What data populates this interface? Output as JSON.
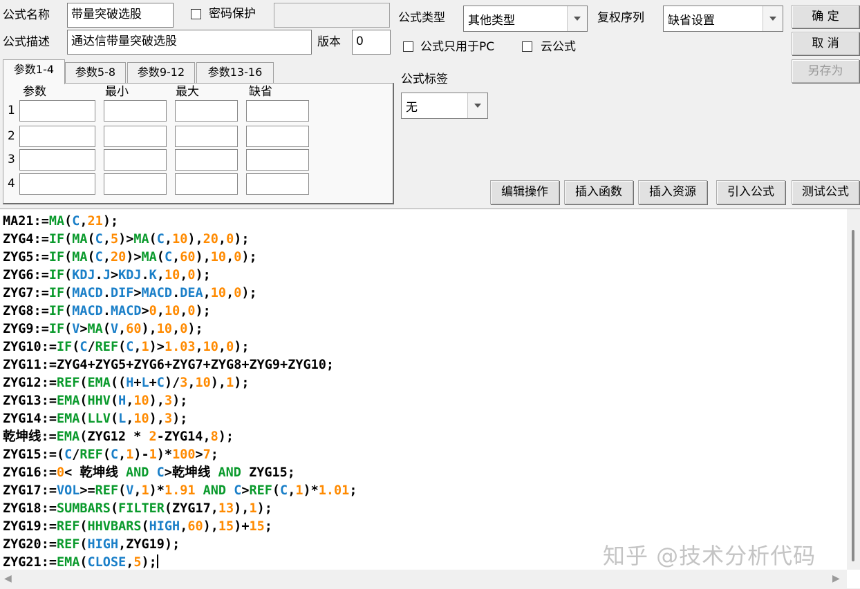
{
  "header": {
    "formula_name_label": "公式名称",
    "formula_name_value": "带量突破选股",
    "password_label": "密码保护",
    "password_checked": false,
    "password_value": "",
    "formula_desc_label": "公式描述",
    "formula_desc_value": "通达信带量突破选股",
    "version_label": "版本",
    "version_value": "0"
  },
  "right": {
    "type_label": "公式类型",
    "type_value": "其他类型",
    "fq_label": "复权序列",
    "fq_value": "缺省设置",
    "pc_only_label": "公式只用于PC",
    "pc_only_checked": false,
    "cloud_label": "云公式",
    "cloud_checked": false,
    "tag_label": "公式标签",
    "tag_value": "无"
  },
  "buttons": {
    "ok": "确  定",
    "cancel": "取  消",
    "save_as": "另存为",
    "edit_ops": "编辑操作",
    "insert_func": "插入函数",
    "insert_res": "插入资源",
    "import_formula": "引入公式",
    "test_formula": "测试公式"
  },
  "tabs": [
    "参数1-4",
    "参数5-8",
    "参数9-12",
    "参数13-16"
  ],
  "params": {
    "headers": [
      "参数",
      "最小",
      "最大",
      "缺省"
    ],
    "rows": [
      "1",
      "2",
      "3",
      "4"
    ]
  },
  "code_lines": [
    "MA21:=MA(C,21);",
    "ZYG4:=IF(MA(C,5)>MA(C,10),20,0);",
    "ZYG5:=IF(MA(C,20)>MA(C,60),10,0);",
    "ZYG6:=IF(KDJ.J>KDJ.K,10,0);",
    "ZYG7:=IF(MACD.DIF>MACD.DEA,10,0);",
    "ZYG8:=IF(MACD.MACD>0,10,0);",
    "ZYG9:=IF(V>MA(V,60),10,0);",
    "ZYG10:=IF(C/REF(C,1)>1.03,10,0);",
    "ZYG11:=ZYG4+ZYG5+ZYG6+ZYG7+ZYG8+ZYG9+ZYG10;",
    "ZYG12:=REF(EMA((H+L+C)/3,10),1);",
    "ZYG13:=EMA(HHV(H,10),3);",
    "ZYG14:=EMA(LLV(L,10),3);",
    "乾坤线:=EMA(ZYG12 * 2-ZYG14,8);",
    "ZYG15:=(C/REF(C,1)-1)*100>7;",
    "ZYG16:=0< 乾坤线 AND C>乾坤线 AND ZYG15;",
    "ZYG17:=VOL>=REF(V,1)*1.91 AND C>REF(C,1)*1.01;",
    "ZYG18:=SUMBARS(FILTER(ZYG17,13),1);",
    "ZYG19:=REF(HHVBARS(HIGH,60),15)+15;",
    "ZYG20:=REF(HIGH,ZYG19);",
    "ZYG21:=EMA(CLOSE,5);"
  ],
  "watermark": "知乎 @技术分析代码",
  "colors": {
    "func": "#0a9a2c",
    "indicator": "#1a7fc8",
    "number": "#ff8a00",
    "text": "#000000"
  }
}
